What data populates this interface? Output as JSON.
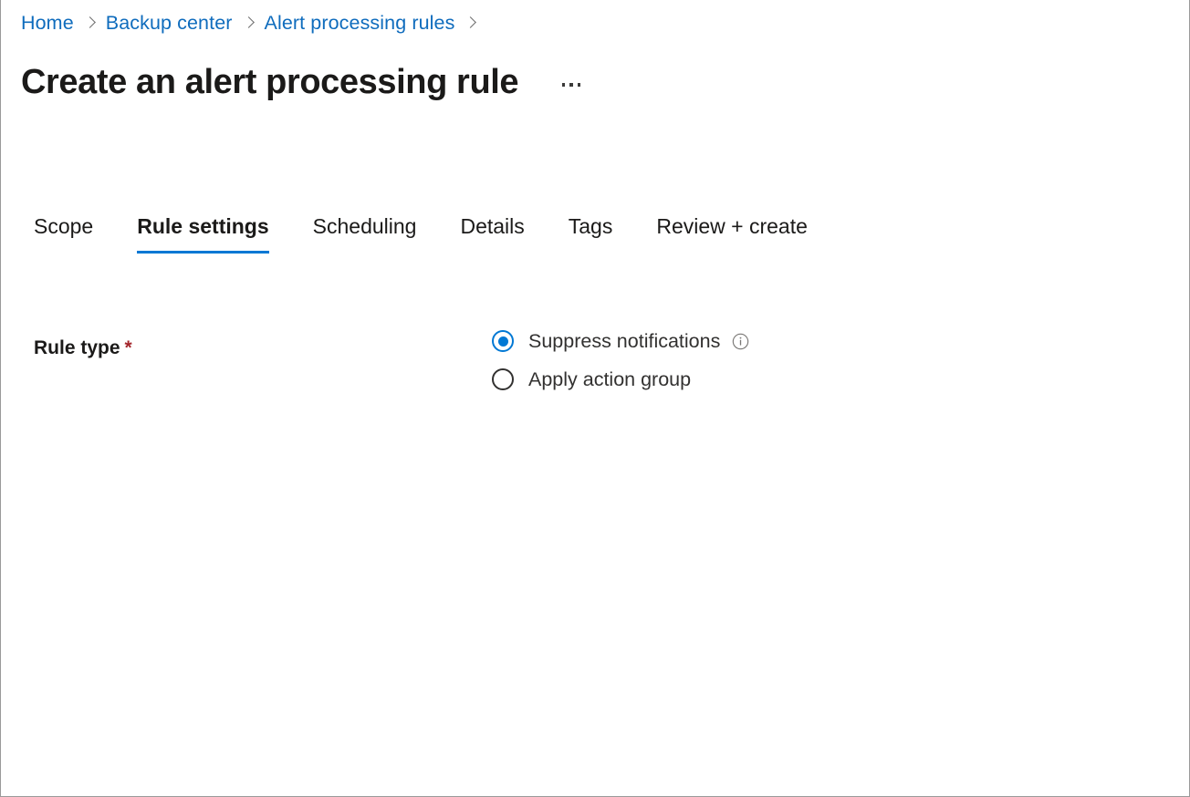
{
  "breadcrumb": {
    "items": [
      {
        "label": "Home"
      },
      {
        "label": "Backup center"
      },
      {
        "label": "Alert processing rules"
      }
    ],
    "separator_icon": "chevron-right-icon",
    "trailing_separator": true
  },
  "header": {
    "title": "Create an alert processing rule",
    "more_icon": "ellipsis-icon",
    "more_label": "More options"
  },
  "tabs": [
    {
      "label": "Scope",
      "active": false
    },
    {
      "label": "Rule settings",
      "active": true
    },
    {
      "label": "Scheduling",
      "active": false
    },
    {
      "label": "Details",
      "active": false
    },
    {
      "label": "Tags",
      "active": false
    },
    {
      "label": "Review + create",
      "active": false
    }
  ],
  "form": {
    "rule_type": {
      "label": "Rule type",
      "required_marker": "*",
      "selected": "Suppress notifications",
      "options": [
        {
          "label": "Suppress notifications",
          "checked": true,
          "info_icon": "info-circle-icon"
        },
        {
          "label": "Apply action group",
          "checked": false,
          "info_icon": null
        }
      ]
    }
  },
  "colors": {
    "accent": "#0078d4",
    "link": "#0f6cbd",
    "text": "#1b1a19",
    "secondary_text": "#323130",
    "required": "#a4262c",
    "border": "#9a9a9a",
    "icon_gray": "#6e6e6e"
  }
}
